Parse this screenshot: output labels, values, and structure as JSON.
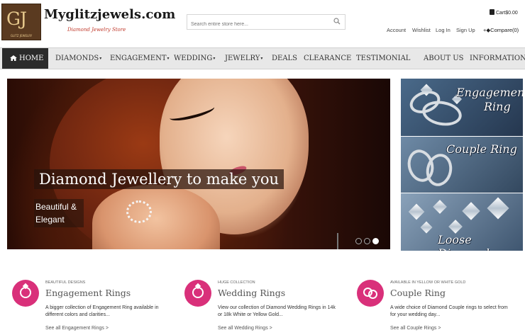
{
  "header": {
    "logo_letters": "GJ",
    "logo_sub": "GLITZ JEWELRY",
    "site_name": "Myglitzjewels.com",
    "tagline": "Diamond Jewelry Store",
    "search_placeholder": "Search entire store here...",
    "cart": "Cart$0.00",
    "links": {
      "account": "Account",
      "wishlist": "Wishlist",
      "login": "Log In",
      "signup": "Sign Up"
    },
    "compare": "Compare(0)"
  },
  "nav": {
    "home": "HOME",
    "items": [
      "DIAMONDS",
      "ENGAGEMENT",
      "WEDDING",
      "JEWELRY",
      "DEALS",
      "CLEARANCE",
      "TESTIMONIAL",
      "ABOUT US",
      "INFORMATION"
    ],
    "has_caret": [
      true,
      true,
      true,
      true,
      false,
      false,
      false,
      false,
      true
    ]
  },
  "hero": {
    "title": "Diamond Jewellery to make you",
    "subtitle_line1": "Beautiful &",
    "subtitle_line2": "Elegant"
  },
  "side_banners": [
    {
      "label_line1": "Engagement",
      "label_line2": "Ring"
    },
    {
      "label_line1": "Couple Ring",
      "label_line2": ""
    },
    {
      "label_line1": "Loose Diamond",
      "label_line2": ""
    }
  ],
  "features": [
    {
      "kicker": "BEAUTIFUL DESIGNS",
      "title": "Engagement Rings",
      "desc": "A bigger collection of Engagement Ring available in different colors and clarities...",
      "link": "See all Engagement Rings >",
      "icon": "ring-icon"
    },
    {
      "kicker": "HUGE COLLECTION",
      "title": "Wedding Rings",
      "desc": "View our collection of Diamond Wedding Rings in 14k or 18k White or Yellow Gold...",
      "link": "See all Wedding Rings >",
      "icon": "ring-icon"
    },
    {
      "kicker": "AVAILABLE IN YELLOW OR WHITE GOLD",
      "title": "Couple Ring",
      "desc": "A wide choice of Diamond Couple rings to select from for your wedding day...",
      "link": "See all Couple Rings >",
      "icon": "couple-rings-icon"
    }
  ],
  "colors": {
    "accent": "#d9307a",
    "nav_bg": "#e8e8e8",
    "home_bg": "#2b2b2b"
  }
}
